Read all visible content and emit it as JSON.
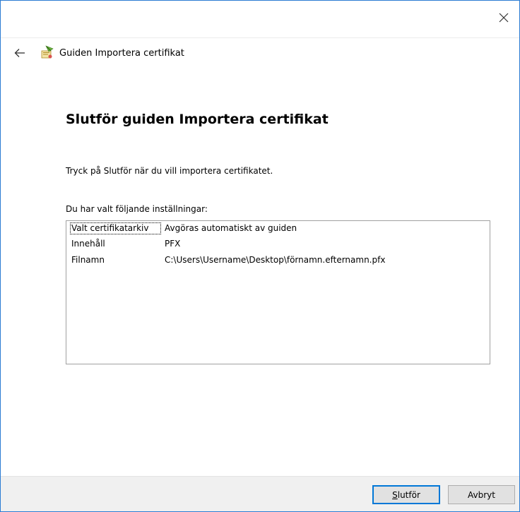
{
  "window": {
    "title": "Guiden Importera certifikat",
    "close_icon": "close-icon",
    "back_icon": "back-arrow-icon",
    "wizard_icon": "certificate-wizard-icon"
  },
  "content": {
    "heading": "Slutför guiden Importera certifikat",
    "instruction": "Tryck på Slutför när du vill importera certifikatet.",
    "settings_label": "Du har valt följande inställningar:",
    "settings": [
      {
        "key": "Valt certifikatarkiv",
        "value": "Avgöras automatiskt av guiden"
      },
      {
        "key": "Innehåll",
        "value": "PFX"
      },
      {
        "key": "Filnamn",
        "value": "C:\\Users\\Username\\Desktop\\förnamn.efternamn.pfx"
      }
    ]
  },
  "footer": {
    "finish_label_mnemonic": "S",
    "finish_label_rest": "lutför",
    "cancel_label": "Avbryt"
  },
  "colors": {
    "accent": "#0078d7",
    "window_border": "#2b7cd3",
    "footer_bg": "#f0f0f0"
  }
}
